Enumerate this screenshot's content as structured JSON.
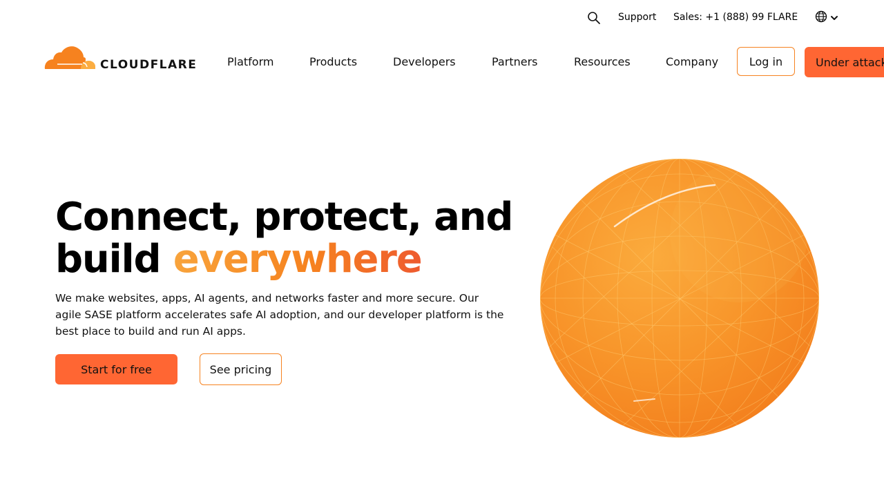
{
  "utility": {
    "search_icon": "search-icon",
    "support_label": "Support",
    "sales_label": "Sales: +1 (888) 99 FLARE",
    "language_icon": "globe-icon"
  },
  "brand": {
    "name": "CLOUDFLARE",
    "accent": "#f6821f",
    "accent_light": "#fbad41",
    "button": "#ff6633"
  },
  "nav": {
    "items": [
      {
        "label": "Platform"
      },
      {
        "label": "Products"
      },
      {
        "label": "Developers"
      },
      {
        "label": "Partners"
      },
      {
        "label": "Resources"
      },
      {
        "label": "Company"
      }
    ],
    "login_label": "Log in",
    "attack_label": "Under attack?"
  },
  "hero": {
    "title_line1": "Connect, protect, and",
    "title_line2_prefix": "build ",
    "title_line2_accent": "everywhere",
    "description": "We make websites, apps, AI agents, and networks faster and more secure. Our agile SASE platform accelerates safe AI adoption, and our developer platform is the best place to build and run AI apps.",
    "primary_cta": "Start for free",
    "secondary_cta": "See pricing"
  }
}
